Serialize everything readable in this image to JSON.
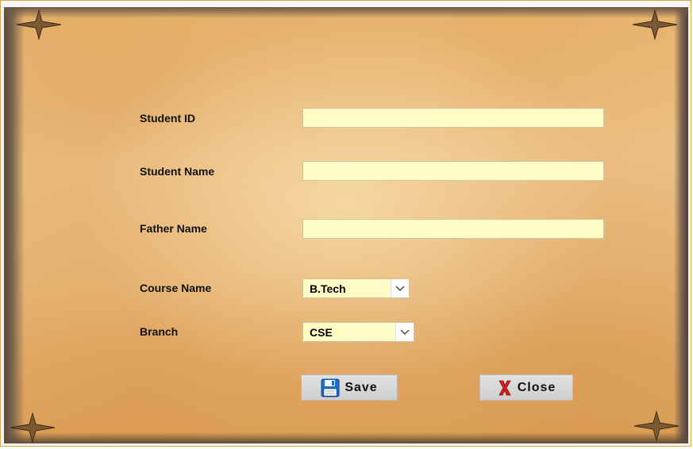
{
  "form": {
    "fields": [
      {
        "label": "Student ID",
        "value": ""
      },
      {
        "label": "Student Name",
        "value": ""
      },
      {
        "label": "Father Name",
        "value": ""
      }
    ],
    "course": {
      "label": "Course Name",
      "selected": "B.Tech"
    },
    "branch": {
      "label": "Branch",
      "selected": "CSE"
    }
  },
  "buttons": {
    "save_label": "Save",
    "close_label": "Close"
  },
  "icons": {
    "save": "floppy-disk-icon",
    "close": "red-x-icon",
    "dropdown": "chevron-down-icon"
  },
  "colors": {
    "input_background": "#fffcc6",
    "parchment": "#e9b772",
    "button_face": "#d8d8d8",
    "close_icon": "#d81e1e",
    "save_icon": "#1d6fc4"
  }
}
